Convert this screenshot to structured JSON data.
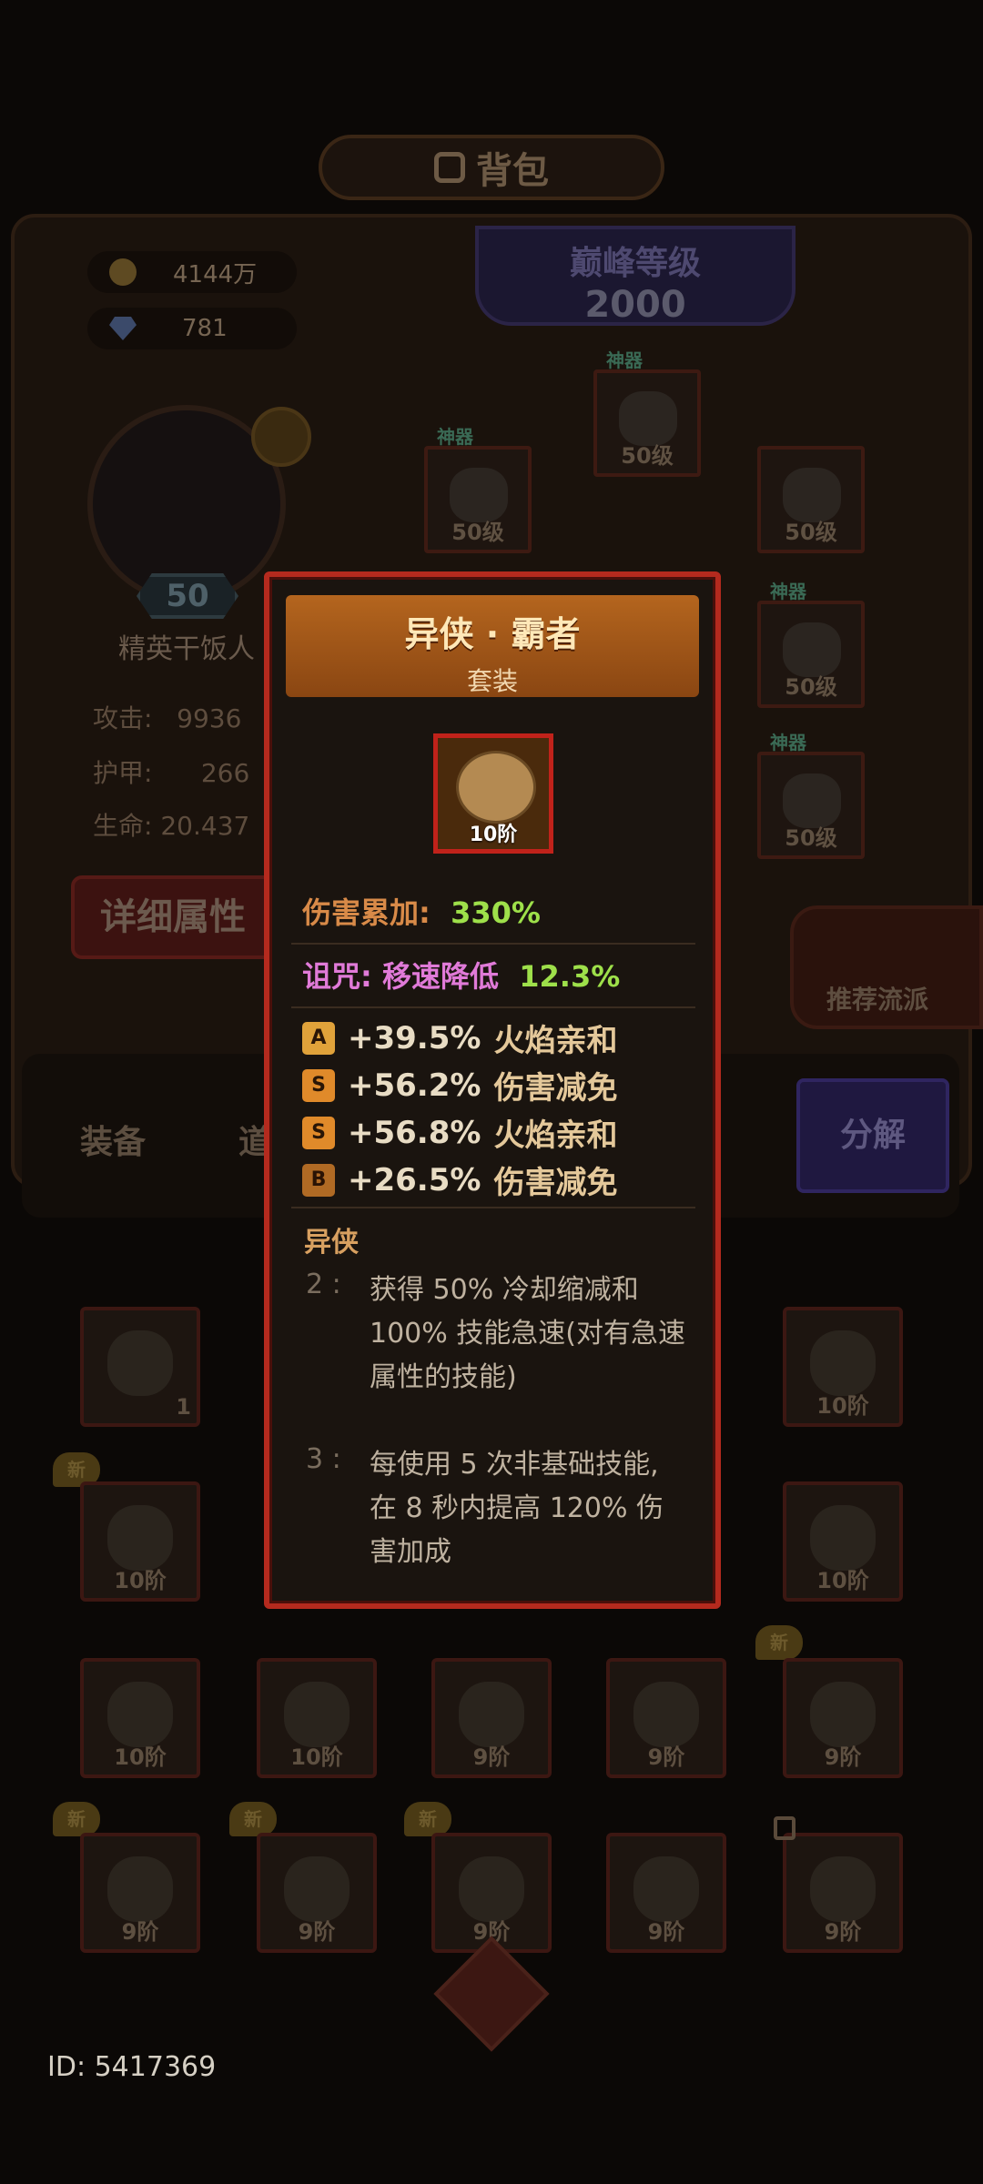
{
  "header": {
    "title": "背包"
  },
  "currency": {
    "gold": "4144万",
    "gems": "781"
  },
  "peak_level": {
    "label": "巅峰等级",
    "value": "2000"
  },
  "player": {
    "level": "50",
    "name": "精英干饭人"
  },
  "stats": [
    {
      "label": "攻击:",
      "value": "9936"
    },
    {
      "label": "护甲:",
      "value": "266"
    },
    {
      "label": "生命:",
      "value": "20.437"
    }
  ],
  "detail_button": "详细属性",
  "equip_slots": [
    {
      "tag": "神器",
      "level": "50级"
    },
    {
      "tag": "神器",
      "level": "50级"
    },
    {
      "tag": "",
      "level": "50级"
    },
    {
      "tag": "神器",
      "level": "50级"
    },
    {
      "tag": "神器",
      "level": "50级"
    }
  ],
  "recommend": "推荐流派",
  "tabs": {
    "equip": "装备",
    "items": "道",
    "split": "分解"
  },
  "inventory": [
    {
      "level": "1",
      "new": false
    },
    {
      "level": "10阶",
      "new": false
    },
    {
      "level": "10阶",
      "new": true
    },
    {
      "level": "10阶",
      "new": false
    },
    {
      "level": "10阶",
      "new": false
    },
    {
      "level": "10阶",
      "new": false
    },
    {
      "level": "9阶",
      "new": false
    },
    {
      "level": "9阶",
      "new": false
    },
    {
      "level": "9阶",
      "new": true
    },
    {
      "level": "9阶",
      "new": true
    },
    {
      "level": "9阶",
      "new": true
    },
    {
      "level": "9阶",
      "new": true
    },
    {
      "level": "9阶",
      "new": false
    },
    {
      "level": "9阶",
      "new": false
    }
  ],
  "new_label": "新",
  "footer": {
    "id": "ID: 5417369"
  },
  "popup": {
    "name": "异侠 · 霸者",
    "type": "套装",
    "item_level": "10阶",
    "damage": {
      "label": "伤害累加:",
      "value": "330%"
    },
    "curse": {
      "label": "诅咒:",
      "effect": "移速降低",
      "value": "12.3%"
    },
    "affixes": [
      {
        "grade": "A",
        "value": "+39.5%",
        "name": "火焰亲和"
      },
      {
        "grade": "S",
        "value": "+56.2%",
        "name": "伤害减免"
      },
      {
        "grade": "S",
        "value": "+56.8%",
        "name": "火焰亲和"
      },
      {
        "grade": "B",
        "value": "+26.5%",
        "name": "伤害减免"
      }
    ],
    "set": {
      "title": "异侠",
      "bonuses": [
        {
          "count": "2",
          "sep": ":",
          "text": "获得 50% 冷却缩减和 100% 技能急速(对有急速属性的技能)"
        },
        {
          "count": "3",
          "sep": ":",
          "text": "每使用 5 次非基础技能, 在 8 秒内提高 120% 伤害加成"
        }
      ]
    }
  },
  "colors": {
    "damage": "#9ee04a",
    "curse": "#e07ad8",
    "popup_border": "#b42a1e",
    "header": "#b4651e"
  }
}
